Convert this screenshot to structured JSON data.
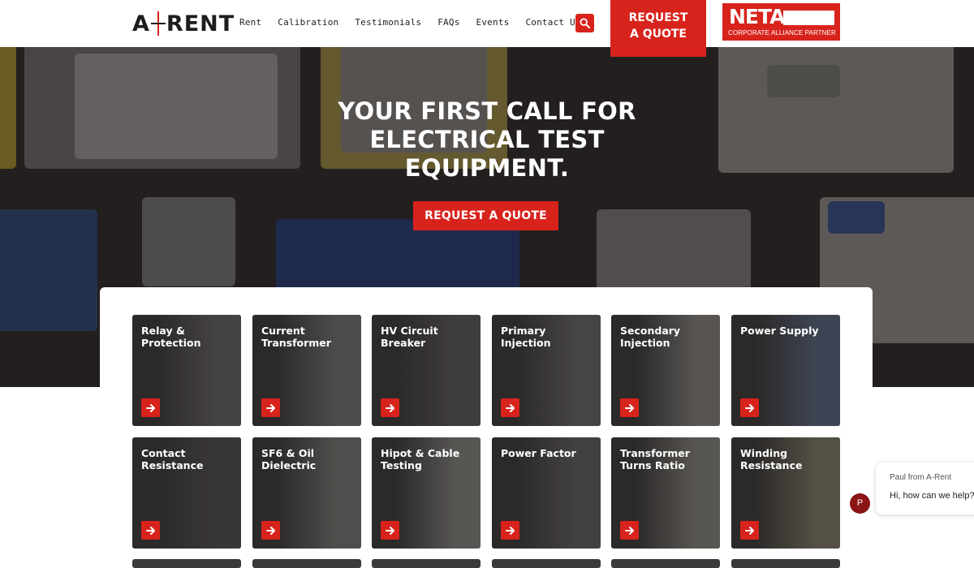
{
  "header": {
    "logo_text": "A-RENT",
    "nav": [
      "Rent",
      "Calibration",
      "Testimonials",
      "FAQs",
      "Events",
      "Contact Us"
    ],
    "search_icon": "search-icon",
    "quote_line1": "REQUEST",
    "quote_line2": "A QUOTE",
    "neta_word": "NETA",
    "neta_sub": "CORPORATE ALLIANCE PARTNER"
  },
  "hero": {
    "title_line1": "YOUR FIRST CALL FOR",
    "title_line2": "ELECTRICAL TEST",
    "title_line3": "EQUIPMENT.",
    "cta_label": "REQUEST A QUOTE"
  },
  "tiles": [
    {
      "label": "Relay & Protection"
    },
    {
      "label": "Current Transformer"
    },
    {
      "label": "HV Circuit Breaker"
    },
    {
      "label": "Primary Injection"
    },
    {
      "label": "Secondary Injection"
    },
    {
      "label": "Power Supply"
    },
    {
      "label": "Contact Resistance"
    },
    {
      "label": "SF6 & Oil Dielectric"
    },
    {
      "label": "Hipot & Cable Testing"
    },
    {
      "label": "Power Factor"
    },
    {
      "label": "Transformer Turns Ratio"
    },
    {
      "label": "Winding Resistance"
    }
  ],
  "chat": {
    "name": "Paul from A-Rent",
    "message": "Hi, how can we help?",
    "avatar_letter": "P"
  },
  "colors": {
    "brand_red": "#d8231c",
    "dark_bg": "#2b2626",
    "text_dark": "#1d1d1d"
  }
}
